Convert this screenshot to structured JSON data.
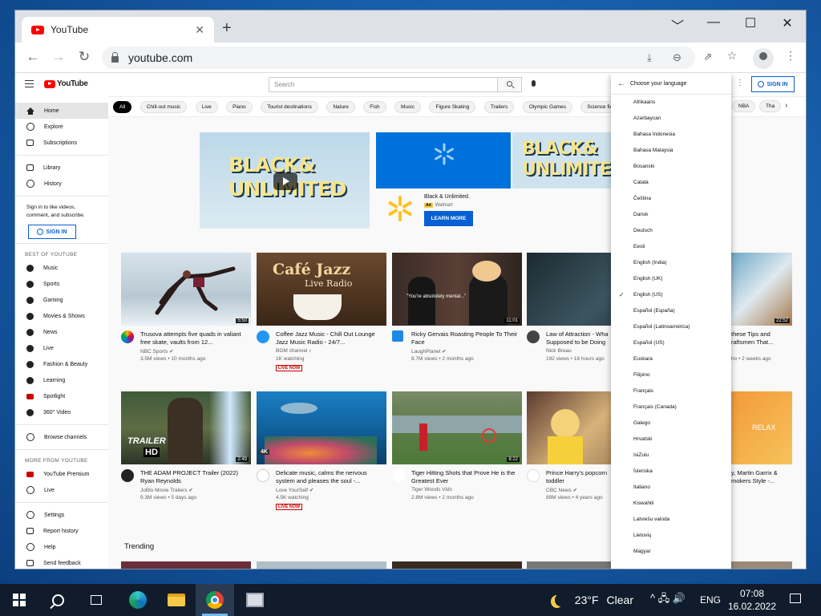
{
  "browser": {
    "tab_title": "YouTube",
    "tab_close": "✕",
    "new_tab": "+",
    "minimize": "﹀",
    "restore": "—",
    "maximize": "☐",
    "close": "✕",
    "back": "←",
    "forward": "→",
    "reload": "↻",
    "url": "youtube.com",
    "toolbar_icons": [
      "install-icon",
      "zoom-icon",
      "share-icon",
      "bookmark-star-icon",
      "profile-icon",
      "menu-icon"
    ]
  },
  "youtube": {
    "logo": "YouTube",
    "search_placeholder": "Search",
    "signin": "SIGN IN",
    "sidebar": {
      "main": [
        {
          "label": "Home",
          "icon": "home-icon"
        },
        {
          "label": "Explore",
          "icon": "compass-icon"
        },
        {
          "label": "Subscriptions",
          "icon": "subscriptions-icon"
        }
      ],
      "library": [
        {
          "label": "Library",
          "icon": "library-icon"
        },
        {
          "label": "History",
          "icon": "history-icon"
        }
      ],
      "signin_note": "Sign in to like videos, comment, and subscribe.",
      "signin_button": "SIGN IN",
      "best_heading": "BEST OF YOUTUBE",
      "best": [
        {
          "label": "Music",
          "icon": "music-icon"
        },
        {
          "label": "Sports",
          "icon": "sports-icon"
        },
        {
          "label": "Gaming",
          "icon": "gaming-icon"
        },
        {
          "label": "Movies & Shows",
          "icon": "movies-icon"
        },
        {
          "label": "News",
          "icon": "news-icon"
        },
        {
          "label": "Live",
          "icon": "live-icon"
        },
        {
          "label": "Fashion & Beauty",
          "icon": "fashion-icon"
        },
        {
          "label": "Learning",
          "icon": "learning-icon"
        },
        {
          "label": "Spotlight",
          "icon": "spotlight-icon"
        },
        {
          "label": "360° Video",
          "icon": "360-video-icon"
        }
      ],
      "browse_channels": "Browse channels",
      "more_heading": "MORE FROM YOUTUBE",
      "more": [
        {
          "label": "YouTube Premium",
          "icon": "youtube-premium-icon"
        },
        {
          "label": "Live",
          "icon": "live-broadcast-icon"
        }
      ],
      "footer": [
        {
          "label": "Settings",
          "icon": "settings-icon"
        },
        {
          "label": "Report history",
          "icon": "flag-icon"
        },
        {
          "label": "Help",
          "icon": "help-icon"
        },
        {
          "label": "Send feedback",
          "icon": "feedback-icon"
        }
      ]
    },
    "chips": [
      "All",
      "Chill-out music",
      "Live",
      "Piano",
      "Tourist destinations",
      "Nature",
      "Fish",
      "Music",
      "Figure Skating",
      "Trailers",
      "Olympic Games",
      "Science fiction",
      "NBA",
      "Tha"
    ],
    "ad": {
      "headline_1": "BLACK&",
      "headline_2": "UNLIMITED",
      "title": "Black & Unlimited.",
      "badge": "Ad",
      "advertiser": "Walmart",
      "cta": "LEARN MORE"
    },
    "videos": [
      {
        "title": "Trusova attempts five quads in valiant free skate, vaults from 12...",
        "channel": "NBC Sports ✔",
        "stats": "3.5M views • 10 months ago",
        "duration": "5:50",
        "live": ""
      },
      {
        "title": "Coffee Jazz Music - Chill Out Lounge Jazz Music Radio - 24/7...",
        "channel": "BGM channel ♪",
        "stats": "1K watching",
        "duration": "",
        "live": "LIVE NOW",
        "overlay_1": "Café Jazz",
        "overlay_2": "Live Radio"
      },
      {
        "title": "Ricky Gervais Roasting People To Their Face",
        "channel": "LaughPlanet ✔",
        "stats": "8.7M views • 2 months ago",
        "duration": "11:01",
        "live": "",
        "overlay_1": "\"You're absolutely mental...\""
      },
      {
        "title": "Law of Attraction - Wha Supposed to be Doing",
        "channel": "Nick Breau",
        "stats": "192 views • 18 hours ago",
        "duration": "",
        "live": ""
      },
      {
        "title": "these Tips and raftsmen That...",
        "channel": "",
        "stats": "ho • 2 weeks ago",
        "duration": "22:52",
        "live": ""
      },
      {
        "title": "THE ADAM PROJECT Trailer (2022) Ryan Reynolds",
        "channel": "JoBlo Movie Trailers ✔",
        "stats": "9.3M views • 5 days ago",
        "duration": "2:49",
        "live": "",
        "overlay_1": "TRAILER",
        "overlay_2": "HD"
      },
      {
        "title": "Delicate music, calms the nervous system and pleases the soul -...",
        "channel": "Love YourSelf ✔",
        "stats": "4.5K watching",
        "duration": "",
        "live": "LIVE NOW",
        "overlay_1": "4K"
      },
      {
        "title": "Tiger Hitting Shots that Prove He is the Greatest Ever",
        "channel": "Tiger Woods Vids",
        "stats": "2.8M views • 2 months ago",
        "duration": "8:22",
        "live": ""
      },
      {
        "title": "Prince Harry's popcorn toddler",
        "channel": "CBC News ✔",
        "stats": "89M views • 4 years ago",
        "duration": "",
        "live": ""
      },
      {
        "title": "y, Martin Garrix & mokers Style -...",
        "channel": "",
        "stats": "",
        "duration": "",
        "live": "",
        "overlay_1": "RELAX"
      }
    ],
    "trending": "Trending"
  },
  "language_menu": {
    "title": "Choose your language",
    "selected": "English (US)",
    "items": [
      "Afrikaans",
      "Azərbaycan",
      "Bahasa Indonesia",
      "Bahasa Malaysia",
      "Bosanski",
      "Català",
      "Čeština",
      "Dansk",
      "Deutsch",
      "Eesti",
      "English (India)",
      "English (UK)",
      "English (US)",
      "Español (España)",
      "Español (Latinoamérica)",
      "Español (US)",
      "Euskara",
      "Filipino",
      "Français",
      "Français (Canada)",
      "Galego",
      "Hrvatski",
      "IsiZulu",
      "Íslenska",
      "Italiano",
      "Kiswahili",
      "Latviešu valoda",
      "Lietuvių",
      "Magyar"
    ]
  },
  "taskbar": {
    "weather_temp": "23°F",
    "weather_text": "Clear",
    "lang": "ENG",
    "time": "07:08",
    "date": "16.02.2022",
    "tray": "^ 🖧 🔊"
  }
}
